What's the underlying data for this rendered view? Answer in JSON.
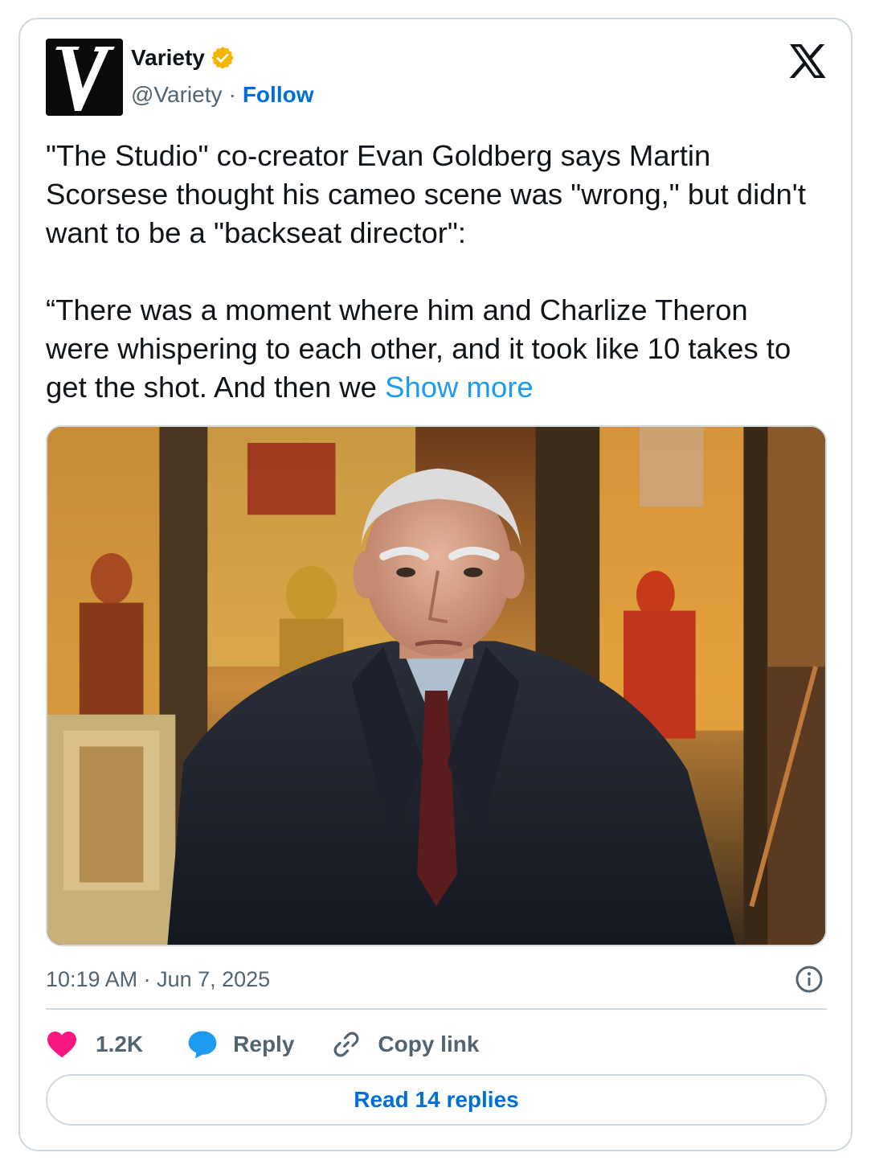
{
  "author": {
    "name": "Variety",
    "handle": "@Variety",
    "separator": "·",
    "follow_label": "Follow",
    "verified_badge_color": "#f4b400",
    "avatar_icon": "variety-v-logo"
  },
  "platform_icon": "x-logo-icon",
  "tweet": {
    "paragraph1": "\"The Studio\" co-creator Evan Goldberg says Martin Scorsese thought his cameo scene was \"wrong,\" but didn't want to be a \"backseat director\":",
    "paragraph2": "“There was a moment where him and Charlize Theron were whispering to each other, and it took like 10 takes to get the shot. And then we",
    "show_more_label": "Show more"
  },
  "media": {
    "type": "image"
  },
  "timestamp": "10:19 AM · Jun 7, 2025",
  "actions": {
    "like_count": "1.2K",
    "reply_label": "Reply",
    "copy_link_label": "Copy link"
  },
  "read_replies_label": "Read 14 replies",
  "colors": {
    "accent": "#1d9bf0",
    "link": "#006fd6",
    "like": "#f91880",
    "border": "#cfd9de",
    "secondary_text": "#536471"
  }
}
